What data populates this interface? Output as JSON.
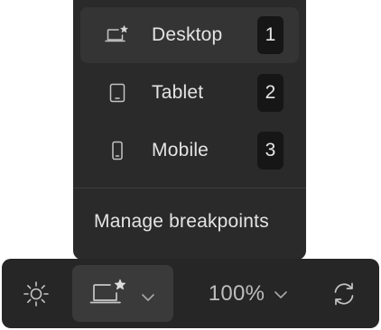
{
  "breakpoint_menu": {
    "items": [
      {
        "label": "Desktop",
        "shortcut": "1",
        "icon": "laptop-star-icon",
        "active": true
      },
      {
        "label": "Tablet",
        "shortcut": "2",
        "icon": "tablet-icon",
        "active": false
      },
      {
        "label": "Mobile",
        "shortcut": "3",
        "icon": "mobile-icon",
        "active": false
      }
    ],
    "manage_label": "Manage breakpoints"
  },
  "toolbar": {
    "theme_icon": "sun-icon",
    "device_icon": "laptop-star-icon",
    "zoom_value": "100%",
    "refresh_icon": "refresh-icon"
  },
  "colors": {
    "panel_bg": "#2a2a2a",
    "active_item_bg": "#343434",
    "toolbar_bg": "#262626",
    "active_button_bg": "#3a3a3a",
    "shortcut_bg": "#161616",
    "text": "#e4e4e4"
  }
}
